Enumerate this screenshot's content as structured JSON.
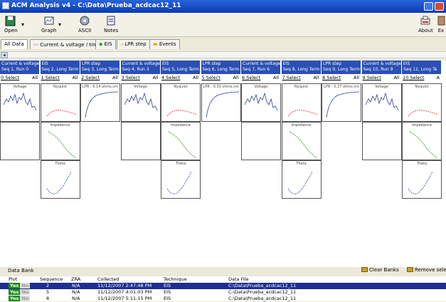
{
  "window": {
    "title": "ACM Analysis v4 - C:\\Data\\Prueba_acdcac12_11"
  },
  "toolbar": {
    "open": "Open",
    "graph": "Graph",
    "ascii": "ASCII",
    "notes": "Notes",
    "about": "About",
    "exit": "Ex"
  },
  "tabs": [
    "All Data",
    "Current & voltage / time",
    "EIS",
    "LPR step",
    "Events"
  ],
  "columns": [
    {
      "title": "Current & voltage",
      "seq": "Seq 1, Run 0",
      "sel": "0 Select",
      "all": "All",
      "plots": [
        "Voltage"
      ]
    },
    {
      "title": "EIS",
      "seq": "Seq 2, Long Term",
      "sel": "1 Select",
      "all": "All",
      "plots": [
        "Nyquist",
        "Impedance",
        "Theta"
      ]
    },
    {
      "title": "LPR step",
      "seq": "Seq 3, Long Term",
      "sel": "2 Select",
      "all": "All",
      "plots": [
        "LPR - 0.14 ohms.cm"
      ]
    },
    {
      "title": "Current & voltage",
      "seq": "Seq 4, Run 3",
      "sel": "3 Select",
      "all": "All",
      "plots": [
        "Voltage"
      ]
    },
    {
      "title": "EIS",
      "seq": "Seq 5, Long Term",
      "sel": "4 Select",
      "all": "All",
      "plots": [
        "Nyquist",
        "Impedance",
        "Theta"
      ]
    },
    {
      "title": "LPR step",
      "seq": "Seq 6, Long Term",
      "sel": "5 Select",
      "all": "All",
      "plots": [
        "LPR - 0.03 ohms.cm"
      ]
    },
    {
      "title": "Current & voltage",
      "seq": "Seq 7, Run 6",
      "sel": "6 Select",
      "all": "All",
      "plots": [
        "Voltage"
      ]
    },
    {
      "title": "EIS",
      "seq": "Seq 8, Long Term",
      "sel": "7 Select",
      "all": "All",
      "plots": [
        "Nyquist",
        "Impedance",
        "Theta"
      ]
    },
    {
      "title": "LPR step",
      "seq": "Seq 9, Long Term",
      "sel": "8 Select",
      "all": "All",
      "plots": [
        "LPR - 0.27 ohms.cm"
      ]
    },
    {
      "title": "Current & voltage",
      "seq": "Seq 10, Run 9",
      "sel": "9 Select",
      "all": "All",
      "plots": [
        "Voltage"
      ]
    },
    {
      "title": "EIS",
      "seq": "Seq 11, Long Te",
      "sel": "10 Select",
      "all": "A",
      "plots": [
        "Nyquist",
        "Impedance",
        "Theta"
      ]
    }
  ],
  "bank": {
    "label": "Data Bank",
    "clear": "Clear Banks",
    "remove": "Remove selec"
  },
  "table": {
    "headers": [
      "Plot",
      "Sequence",
      "ZRA",
      "Collected",
      "Technique",
      "Data File"
    ],
    "rows": [
      {
        "yes": "Yes",
        "no": "No",
        "seq": "2",
        "zra": "N/A",
        "collected": "11/12/2007 2:47:48 PM",
        "tech": "EIS",
        "file": "C:\\Data\\Prueba_acdcac12_11"
      },
      {
        "yes": "Yes",
        "no": "No",
        "seq": "5",
        "zra": "N/A",
        "collected": "11/12/2007 4:01:03 PM",
        "tech": "EIS",
        "file": "C:\\Data\\Prueba_acdcac12_11"
      },
      {
        "yes": "Yes",
        "no": "No",
        "seq": "8",
        "zra": "N/A",
        "collected": "11/12/2007 5:11:15 PM",
        "tech": "EIS",
        "file": "C:\\Data\\Prueba_acdcac12_11"
      }
    ]
  }
}
